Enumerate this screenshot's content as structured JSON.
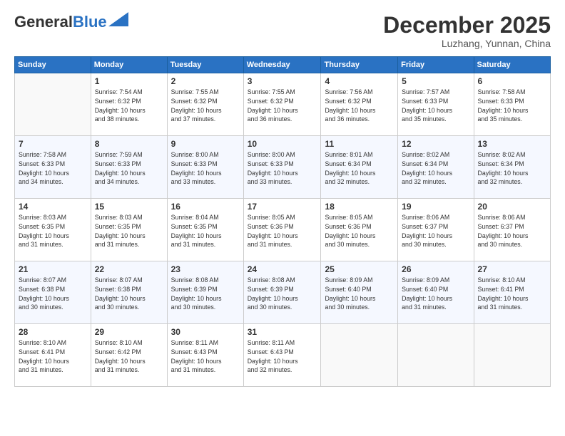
{
  "header": {
    "logo_general": "General",
    "logo_blue": "Blue",
    "title": "December 2025",
    "subtitle": "Luzhang, Yunnan, China"
  },
  "days_of_week": [
    "Sunday",
    "Monday",
    "Tuesday",
    "Wednesday",
    "Thursday",
    "Friday",
    "Saturday"
  ],
  "weeks": [
    [
      {
        "day": "",
        "info": ""
      },
      {
        "day": "1",
        "info": "Sunrise: 7:54 AM\nSunset: 6:32 PM\nDaylight: 10 hours\nand 38 minutes."
      },
      {
        "day": "2",
        "info": "Sunrise: 7:55 AM\nSunset: 6:32 PM\nDaylight: 10 hours\nand 37 minutes."
      },
      {
        "day": "3",
        "info": "Sunrise: 7:55 AM\nSunset: 6:32 PM\nDaylight: 10 hours\nand 36 minutes."
      },
      {
        "day": "4",
        "info": "Sunrise: 7:56 AM\nSunset: 6:32 PM\nDaylight: 10 hours\nand 36 minutes."
      },
      {
        "day": "5",
        "info": "Sunrise: 7:57 AM\nSunset: 6:33 PM\nDaylight: 10 hours\nand 35 minutes."
      },
      {
        "day": "6",
        "info": "Sunrise: 7:58 AM\nSunset: 6:33 PM\nDaylight: 10 hours\nand 35 minutes."
      }
    ],
    [
      {
        "day": "7",
        "info": "Sunrise: 7:58 AM\nSunset: 6:33 PM\nDaylight: 10 hours\nand 34 minutes."
      },
      {
        "day": "8",
        "info": "Sunrise: 7:59 AM\nSunset: 6:33 PM\nDaylight: 10 hours\nand 34 minutes."
      },
      {
        "day": "9",
        "info": "Sunrise: 8:00 AM\nSunset: 6:33 PM\nDaylight: 10 hours\nand 33 minutes."
      },
      {
        "day": "10",
        "info": "Sunrise: 8:00 AM\nSunset: 6:33 PM\nDaylight: 10 hours\nand 33 minutes."
      },
      {
        "day": "11",
        "info": "Sunrise: 8:01 AM\nSunset: 6:34 PM\nDaylight: 10 hours\nand 32 minutes."
      },
      {
        "day": "12",
        "info": "Sunrise: 8:02 AM\nSunset: 6:34 PM\nDaylight: 10 hours\nand 32 minutes."
      },
      {
        "day": "13",
        "info": "Sunrise: 8:02 AM\nSunset: 6:34 PM\nDaylight: 10 hours\nand 32 minutes."
      }
    ],
    [
      {
        "day": "14",
        "info": "Sunrise: 8:03 AM\nSunset: 6:35 PM\nDaylight: 10 hours\nand 31 minutes."
      },
      {
        "day": "15",
        "info": "Sunrise: 8:03 AM\nSunset: 6:35 PM\nDaylight: 10 hours\nand 31 minutes."
      },
      {
        "day": "16",
        "info": "Sunrise: 8:04 AM\nSunset: 6:35 PM\nDaylight: 10 hours\nand 31 minutes."
      },
      {
        "day": "17",
        "info": "Sunrise: 8:05 AM\nSunset: 6:36 PM\nDaylight: 10 hours\nand 31 minutes."
      },
      {
        "day": "18",
        "info": "Sunrise: 8:05 AM\nSunset: 6:36 PM\nDaylight: 10 hours\nand 30 minutes."
      },
      {
        "day": "19",
        "info": "Sunrise: 8:06 AM\nSunset: 6:37 PM\nDaylight: 10 hours\nand 30 minutes."
      },
      {
        "day": "20",
        "info": "Sunrise: 8:06 AM\nSunset: 6:37 PM\nDaylight: 10 hours\nand 30 minutes."
      }
    ],
    [
      {
        "day": "21",
        "info": "Sunrise: 8:07 AM\nSunset: 6:38 PM\nDaylight: 10 hours\nand 30 minutes."
      },
      {
        "day": "22",
        "info": "Sunrise: 8:07 AM\nSunset: 6:38 PM\nDaylight: 10 hours\nand 30 minutes."
      },
      {
        "day": "23",
        "info": "Sunrise: 8:08 AM\nSunset: 6:39 PM\nDaylight: 10 hours\nand 30 minutes."
      },
      {
        "day": "24",
        "info": "Sunrise: 8:08 AM\nSunset: 6:39 PM\nDaylight: 10 hours\nand 30 minutes."
      },
      {
        "day": "25",
        "info": "Sunrise: 8:09 AM\nSunset: 6:40 PM\nDaylight: 10 hours\nand 30 minutes."
      },
      {
        "day": "26",
        "info": "Sunrise: 8:09 AM\nSunset: 6:40 PM\nDaylight: 10 hours\nand 31 minutes."
      },
      {
        "day": "27",
        "info": "Sunrise: 8:10 AM\nSunset: 6:41 PM\nDaylight: 10 hours\nand 31 minutes."
      }
    ],
    [
      {
        "day": "28",
        "info": "Sunrise: 8:10 AM\nSunset: 6:41 PM\nDaylight: 10 hours\nand 31 minutes."
      },
      {
        "day": "29",
        "info": "Sunrise: 8:10 AM\nSunset: 6:42 PM\nDaylight: 10 hours\nand 31 minutes."
      },
      {
        "day": "30",
        "info": "Sunrise: 8:11 AM\nSunset: 6:43 PM\nDaylight: 10 hours\nand 31 minutes."
      },
      {
        "day": "31",
        "info": "Sunrise: 8:11 AM\nSunset: 6:43 PM\nDaylight: 10 hours\nand 32 minutes."
      },
      {
        "day": "",
        "info": ""
      },
      {
        "day": "",
        "info": ""
      },
      {
        "day": "",
        "info": ""
      }
    ]
  ]
}
